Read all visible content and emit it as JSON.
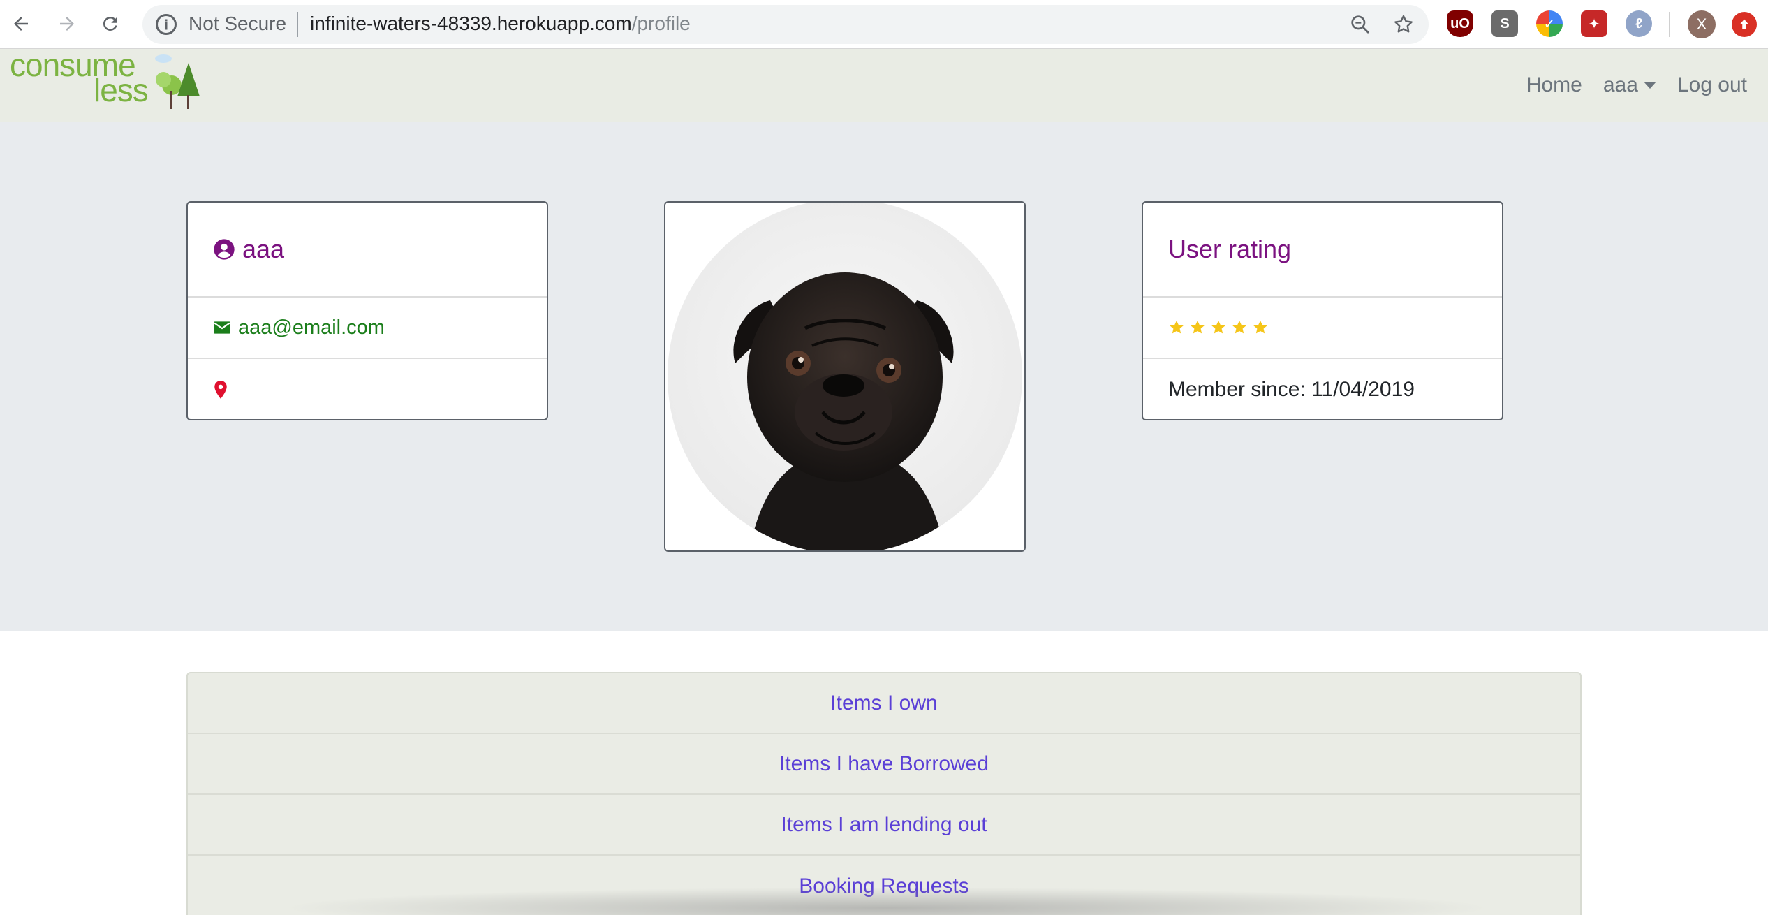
{
  "browser": {
    "security_label": "Not Secure",
    "url_host": "infinite-waters-48339.herokuapp.com",
    "url_path": "/profile",
    "avatar_letter": "X",
    "extensions": [
      "ublock-icon",
      "s-extension-icon",
      "google-keep-icon",
      "puzzle-extension-icon",
      "o-extension-icon"
    ]
  },
  "nav": {
    "logo_line1": "consume",
    "logo_line2": "less",
    "home": "Home",
    "user": "aaa",
    "logout": "Log out"
  },
  "profile": {
    "username": "aaa",
    "email": "aaa@email.com",
    "location": ""
  },
  "rating": {
    "title": "User rating",
    "stars": 5,
    "member_since": "Member since: 11/04/2019"
  },
  "colors": {
    "accent_purple": "#7b1280",
    "email_green": "#1b7e1b",
    "star_yellow": "#f5c518",
    "location_red": "#e0102f",
    "link_purple": "#5a3fd6"
  },
  "tabs": [
    "Items I own",
    "Items I have Borrowed",
    "Items I am lending out",
    "Booking Requests"
  ]
}
